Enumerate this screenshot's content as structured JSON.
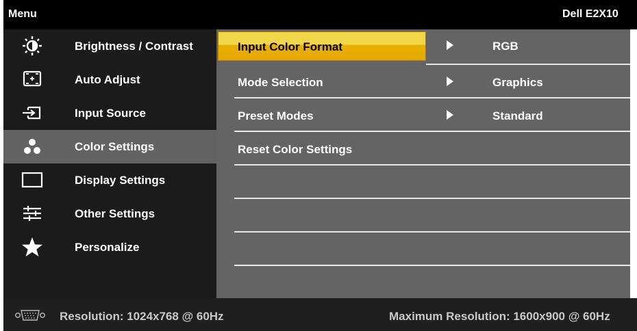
{
  "header": {
    "title": "Menu",
    "model": "Dell E2X10"
  },
  "left_menu": {
    "items": [
      {
        "label": "Brightness / Contrast",
        "icon": "brightness-icon"
      },
      {
        "label": "Auto Adjust",
        "icon": "auto-adjust-icon"
      },
      {
        "label": "Input Source",
        "icon": "input-source-icon"
      },
      {
        "label": "Color Settings",
        "icon": "color-settings-icon",
        "selected": true
      },
      {
        "label": "Display Settings",
        "icon": "display-icon"
      },
      {
        "label": "Other Settings",
        "icon": "sliders-icon"
      },
      {
        "label": "Personalize",
        "icon": "star-icon"
      }
    ]
  },
  "submenu": {
    "rows": [
      {
        "label": "Input Color Format",
        "value": "RGB",
        "highlighted": true
      },
      {
        "label": "Mode Selection",
        "value": "Graphics"
      },
      {
        "label": "Preset Modes",
        "value": "Standard"
      },
      {
        "label": "Reset Color Settings"
      }
    ]
  },
  "footer": {
    "resolution": "Resolution: 1024x768 @ 60Hz",
    "max_resolution": "Maximum Resolution: 1600x900 @ 60Hz"
  },
  "colors": {
    "highlight": "#e8b000",
    "selected_bg": "#636363",
    "panel_bg": "#646464"
  }
}
